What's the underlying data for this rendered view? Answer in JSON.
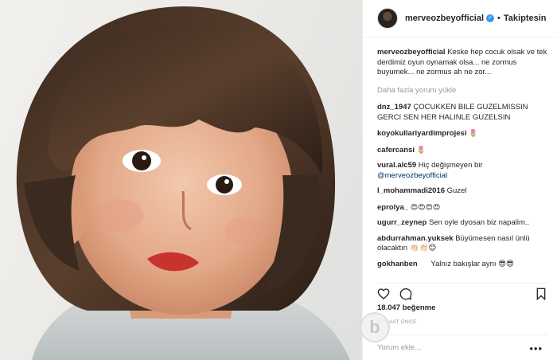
{
  "header": {
    "username": "merveozbeyofficial",
    "separator": "•",
    "follow_label": "Takiptesin",
    "verified_icon": "✓"
  },
  "caption": {
    "user": "merveozbeyofficial",
    "text": "Keske hep cocuk olsak ve tek derdimiz oyun oynamak olsa... ne zormus buyumek... ne zormus ah ne zor..."
  },
  "load_more": "Daha fazla yorum yükle",
  "comments": [
    {
      "user": "dnz_1947",
      "text": "ÇOCUKKEN BILE GUZELMISSIN GERCI SEN HER HALINLE GUZELSIN"
    },
    {
      "user": "koyokullariyardimprojesi",
      "text": "🌷"
    },
    {
      "user": "cafercansi",
      "text": "🌷"
    },
    {
      "user": "vural.alc59",
      "text": "Hiç değişmeyen bir",
      "mention": "@merveozbeyofficial"
    },
    {
      "user": "l_mohammadi2016",
      "text": "Guzel"
    },
    {
      "user": "eprolya_",
      "text": "😍😍😍😍"
    },
    {
      "user": "ugurr_zeynep",
      "text": "Sen oyle dyosan biz napalim.."
    },
    {
      "user": "abdurrahman.yuksek",
      "text": "Büyümesen nasıl ünlü olacaktın 👏🏻👏🏻😊"
    },
    {
      "user": "gokhanben",
      "text": "Yalnız bakışlar aynı 😎😎"
    }
  ],
  "likes": "18.047 beğenme",
  "timestamp": "12 SAAT ÖNCE",
  "add_comment_placeholder": "Yorum ekle...",
  "more_options": "•••",
  "watermark": "b"
}
